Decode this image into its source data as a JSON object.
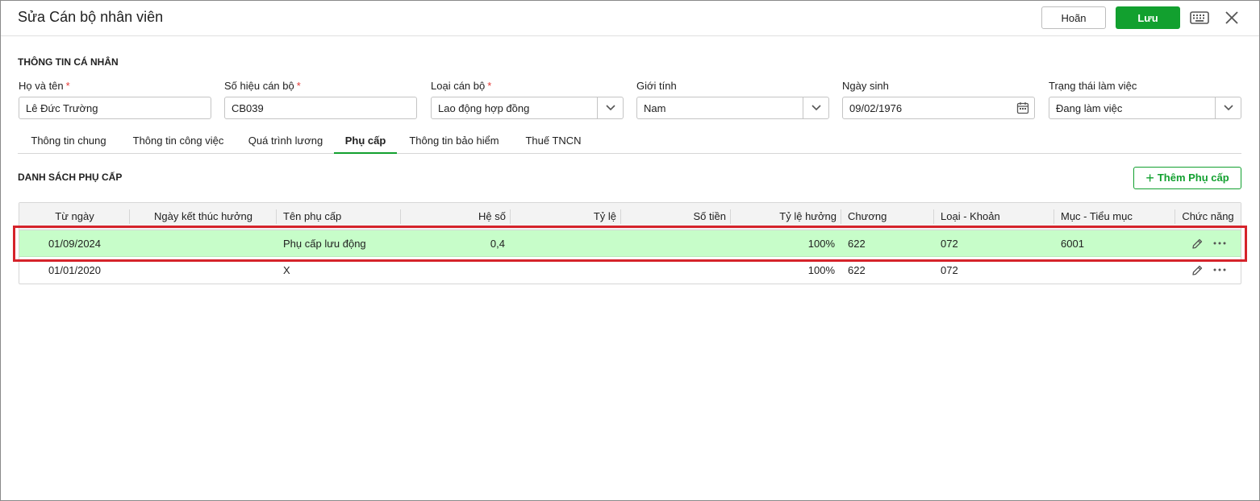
{
  "header": {
    "title": "Sửa Cán bộ nhân viên",
    "cancel_label": "Hoãn",
    "save_label": "Lưu"
  },
  "personal_section": {
    "title": "THÔNG TIN CÁ NHÂN",
    "fields": [
      {
        "label": "Họ và tên",
        "required": "*",
        "value": "Lê Đức Trường"
      },
      {
        "label": "Số hiệu cán bộ",
        "required": "*",
        "value": "CB039"
      },
      {
        "label": "Loại cán bộ",
        "required": "*",
        "value": "Lao động hợp đồng"
      },
      {
        "label": "Giới tính",
        "value": "Nam"
      },
      {
        "label": "Ngày sinh",
        "value": "09/02/1976"
      },
      {
        "label": "Trạng thái làm việc",
        "value": "Đang làm việc"
      }
    ]
  },
  "tabs": [
    {
      "label": "Thông tin chung"
    },
    {
      "label": "Thông tin công việc"
    },
    {
      "label": "Quá trình lương"
    },
    {
      "label": "Phụ cấp"
    },
    {
      "label": "Thông tin bảo hiểm"
    },
    {
      "label": "Thuế TNCN"
    }
  ],
  "active_tab": "Phụ cấp",
  "allowance": {
    "title": "DANH SÁCH PHỤ CẤP",
    "add_label": "Thêm Phụ cấp",
    "columns": [
      "Từ ngày",
      "Ngày kết thúc hưởng",
      "Tên phụ cấp",
      "Hệ số",
      "Tỷ lệ",
      "Số tiền",
      "Tỷ lệ hưởng",
      "Chương",
      "Loại - Khoản",
      "Mục - Tiểu mục",
      "Chức năng"
    ],
    "rows": [
      {
        "from_date": "01/09/2024",
        "end_date": "",
        "name": "Phụ cấp lưu động",
        "coefficient": "0,4",
        "rate": "",
        "amount": "",
        "benefit_rate": "100%",
        "chapter": "622",
        "type_item": "072",
        "section_subsection": "6001"
      },
      {
        "from_date": "01/01/2020",
        "end_date": "",
        "name": "X",
        "coefficient": "",
        "rate": "",
        "amount": "",
        "benefit_rate": "100%",
        "chapter": "622",
        "type_item": "072",
        "section_subsection": ""
      }
    ]
  },
  "colors": {
    "accent": "#12a02f",
    "selected_row": "#c7fdc9",
    "highlight_border": "#d5232b",
    "required": "#e53935"
  }
}
